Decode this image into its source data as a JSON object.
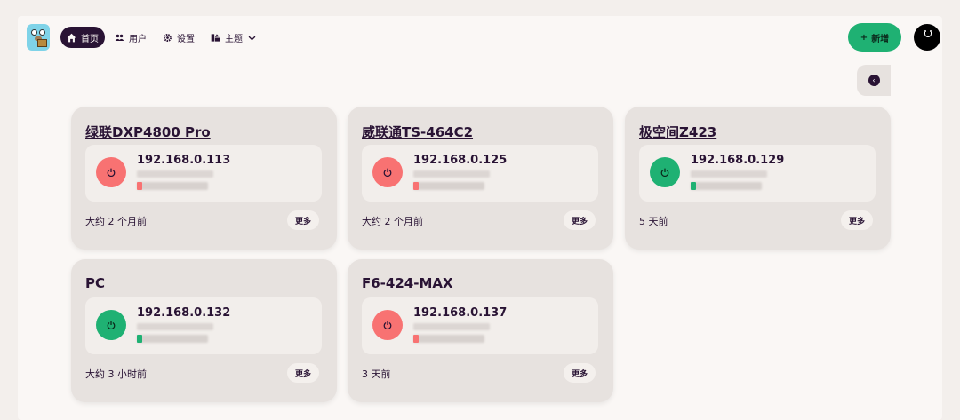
{
  "nav": {
    "home": "首页",
    "users": "用户",
    "settings": "设置",
    "theme": "主题",
    "add": "新增"
  },
  "colors": {
    "online": "#1fb173",
    "offline": "#f87272",
    "primary_dark": "#291334"
  },
  "devices": [
    {
      "name": "绿联DXP4800 Pro",
      "link": true,
      "ip": "192.168.0.113",
      "status": "offline",
      "time": "大约 2 个月前",
      "more": "更多"
    },
    {
      "name": "威联通TS-464C2",
      "link": true,
      "ip": "192.168.0.125",
      "status": "offline",
      "time": "大约 2 个月前",
      "more": "更多"
    },
    {
      "name": "极空间Z423",
      "link": true,
      "ip": "192.168.0.129",
      "status": "online",
      "time": "5 天前",
      "more": "更多"
    },
    {
      "name": "PC",
      "link": false,
      "ip": "192.168.0.132",
      "status": "online",
      "time": "大约 3 小时前",
      "more": "更多"
    },
    {
      "name": "F6-424-MAX",
      "link": true,
      "ip": "192.168.0.137",
      "status": "offline",
      "time": "3 天前",
      "more": "更多"
    }
  ]
}
